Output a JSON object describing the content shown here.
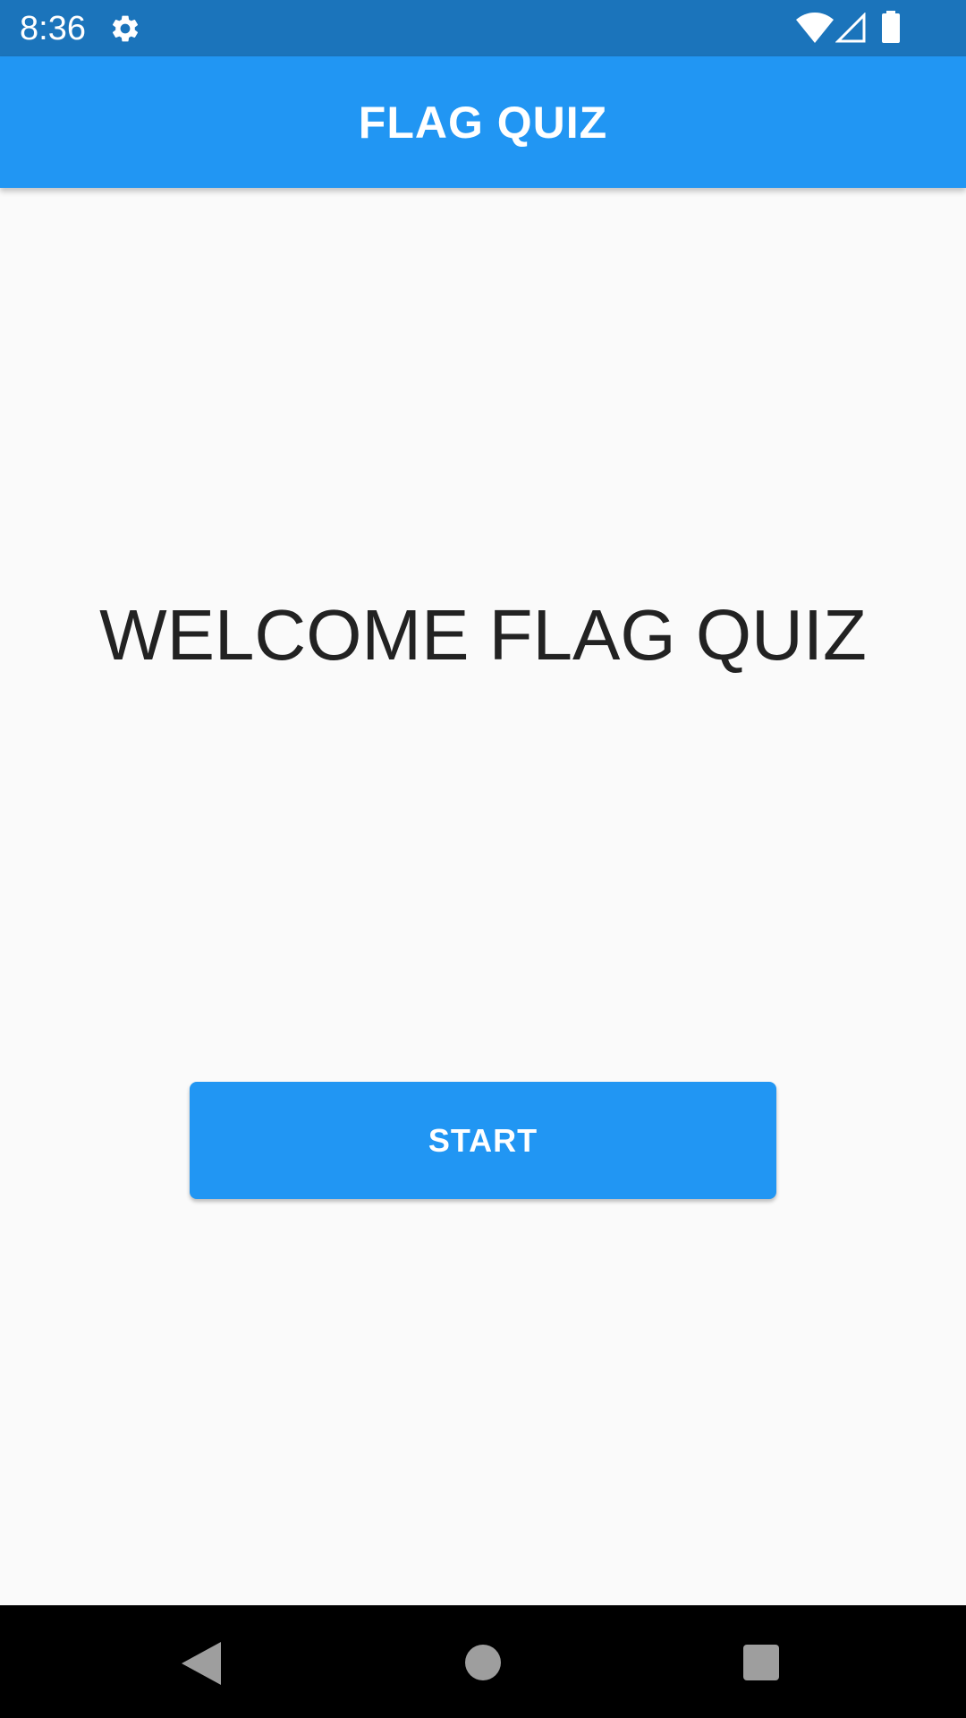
{
  "status_bar": {
    "time": "8:36",
    "icons": [
      "gear-icon",
      "wifi-icon",
      "cell-signal-icon",
      "battery-icon"
    ],
    "background": "#1b74bb"
  },
  "app_bar": {
    "title": "FLAG QUIZ",
    "background": "#2196f3"
  },
  "main": {
    "welcome_text": "WELCOME FLAG QUIZ",
    "start_button_label": "START",
    "button_color": "#2196f3"
  },
  "nav_bar": {
    "icons": [
      "back-icon",
      "home-icon",
      "recents-icon"
    ]
  }
}
